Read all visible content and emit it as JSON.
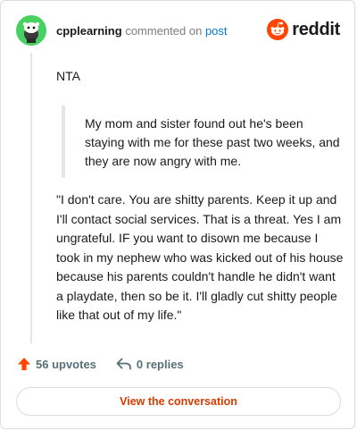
{
  "header": {
    "username": "cpplearning",
    "action_text": "commented on",
    "post_link_text": "post",
    "brand_name": "reddit"
  },
  "comment": {
    "verdict": "NTA",
    "quote": "My mom and sister found out he's been staying with me for these past two weeks, and they are now angry with me.",
    "reply": "\"I don't care. You are shitty parents. Keep it up and I'll contact social services. That is a threat. Yes I am ungrateful. IF you want to disown me because I took in my nephew who was kicked out of his house because his parents couldn't handle he didn't want a playdate, then so be it. I'll gladly cut shitty people like that out of my life.\""
  },
  "actions": {
    "upvotes_label": "56 upvotes",
    "replies_label": "0 replies"
  },
  "cta": {
    "label": "View the conversation"
  },
  "colors": {
    "brand_orange": "#ff4500",
    "link_blue": "#0079d3",
    "cta_text": "#d93a00",
    "avatar_green": "#46d160",
    "icon_gray": "#576f76"
  },
  "icons": [
    "snoo-avatar-icon",
    "reddit-logo-icon",
    "upvote-arrow-icon",
    "reply-arrow-icon"
  ]
}
